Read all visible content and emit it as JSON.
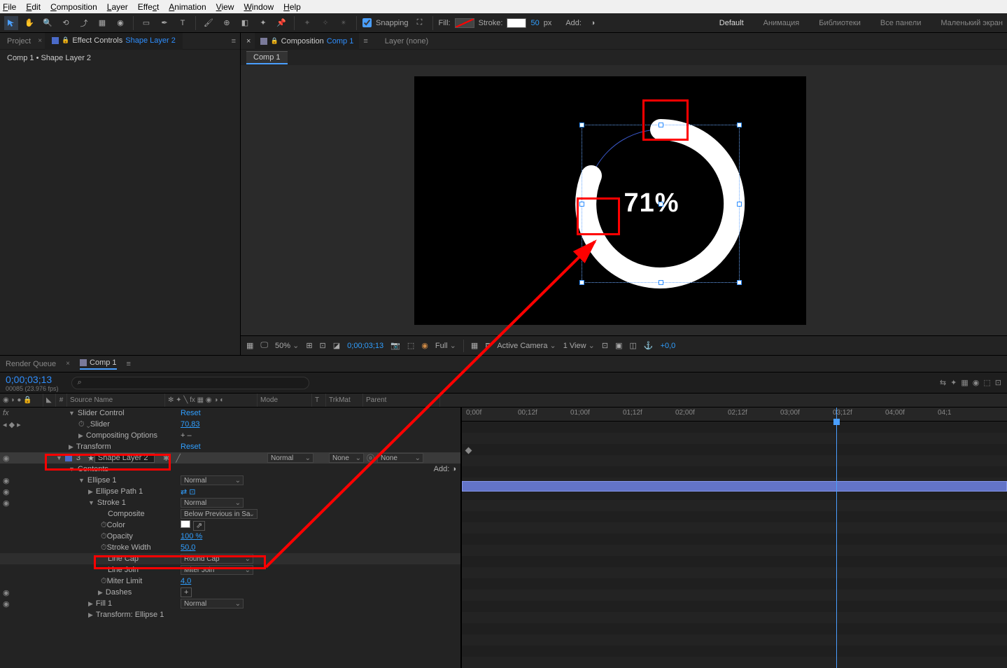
{
  "menu": {
    "file": "File",
    "edit": "Edit",
    "composition": "Composition",
    "layer": "Layer",
    "effect": "Effect",
    "animation": "Animation",
    "view": "View",
    "window": "Window",
    "help": "Help"
  },
  "toolbar": {
    "snapping": "Snapping",
    "fill": "Fill:",
    "stroke": "Stroke:",
    "stroke_width": "50",
    "stroke_unit": "px",
    "add": "Add:"
  },
  "workspaces": [
    "Default",
    "Анимация",
    "Библиотеки",
    "Все панели",
    "Маленький экран"
  ],
  "panels": {
    "project": "Project",
    "effect_controls_prefix": "Effect Controls ",
    "effect_controls_layer": "Shape Layer 2",
    "panel_path": "Comp 1 • Shape Layer 2"
  },
  "viewer": {
    "composition_prefix": "Composition ",
    "composition_name": "Comp 1",
    "layer_none": "Layer (none)",
    "comp_tab": "Comp 1",
    "percent_text": "71%",
    "footer": {
      "zoom": "50%",
      "time": "0;00;03;13",
      "res": "Full",
      "camera": "Active Camera",
      "view": "1 View",
      "exposure": "+0,0"
    }
  },
  "timeline": {
    "tabs": {
      "render_queue": "Render Queue",
      "comp": "Comp 1"
    },
    "timecode": "0;00;03;13",
    "frameinfo": "00085 (23.976 fps)",
    "search_placeholder": "⌕",
    "cols": {
      "source": "Source Name",
      "mode": "Mode",
      "t": "T",
      "trkmat": "TrkMat",
      "parent": "Parent"
    },
    "rows": {
      "slider_control": "Slider Control",
      "reset": "Reset",
      "slider": "Slider",
      "slider_val": "70,83",
      "compositing": "Compositing Options",
      "plus_minus": "+ –",
      "transform": "Transform",
      "reset2": "Reset",
      "layer_num": "3",
      "layer_name": "Shape Layer 2",
      "mode_normal": "Normal",
      "trkmat_none": "None",
      "parent_none": "None",
      "contents": "Contents",
      "add": "Add:",
      "ellipse1": "Ellipse 1",
      "ellipse_mode": "Normal",
      "ellipse_path": "Ellipse Path 1",
      "stroke1": "Stroke 1",
      "stroke_mode": "Normal",
      "composite": "Composite",
      "composite_val": "Below Previous in Sa",
      "color": "Color",
      "opacity": "Opacity",
      "opacity_val": "100 %",
      "stroke_width": "Stroke Width",
      "stroke_width_val": "50,0",
      "line_cap": "Line Cap",
      "line_cap_val": "Round Cap",
      "line_join": "Line Join",
      "line_join_val": "Miter Join",
      "miter_limit": "Miter Limit",
      "miter_limit_val": "4,0",
      "dashes": "Dashes",
      "dashes_plus": "+",
      "fill1": "Fill 1",
      "fill_mode": "Normal",
      "transform_ellipse": "Transform: Ellipse 1"
    },
    "ruler": [
      "0;00f",
      "00;12f",
      "01;00f",
      "01;12f",
      "02;00f",
      "02;12f",
      "03;00f",
      "03;12f",
      "04;00f",
      "04;1"
    ]
  }
}
